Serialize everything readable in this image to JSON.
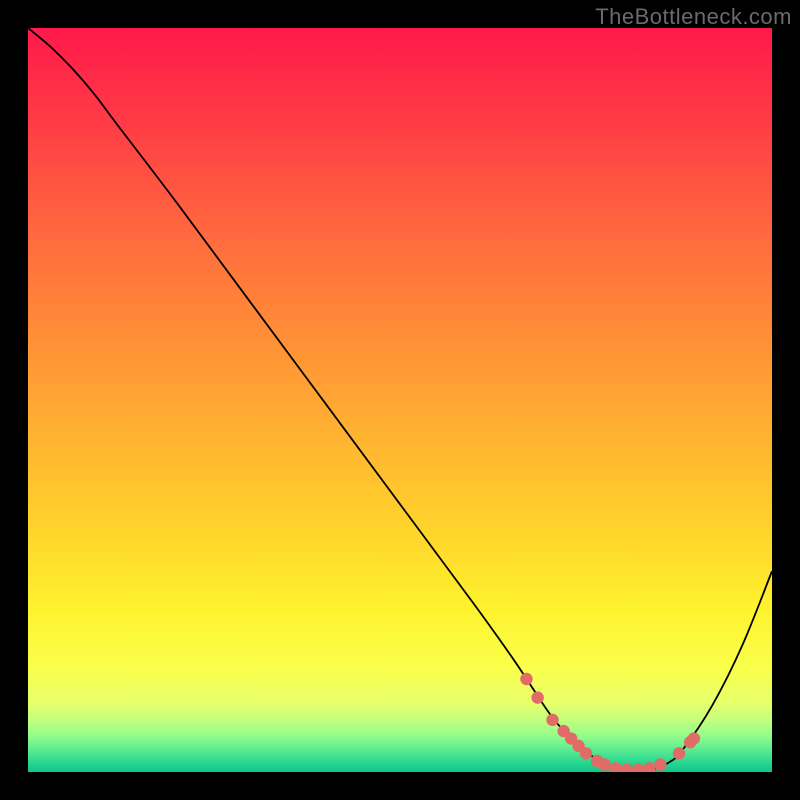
{
  "watermark": "TheBottleneck.com",
  "chart_data": {
    "type": "line",
    "title": "",
    "xlabel": "",
    "ylabel": "",
    "xlim": [
      0,
      100
    ],
    "ylim": [
      0,
      100
    ],
    "grid": false,
    "series": [
      {
        "name": "curve",
        "x": [
          0,
          3,
          6,
          9,
          12,
          20,
          30,
          40,
          50,
          60,
          65,
          68,
          70,
          72,
          74,
          76,
          78,
          80,
          82,
          84,
          86,
          88,
          92,
          96,
          100
        ],
        "y": [
          100,
          97.5,
          94.5,
          91,
          87,
          76.5,
          63,
          49.5,
          36,
          22.5,
          15.5,
          11,
          8,
          5.5,
          3.5,
          2,
          1,
          0.4,
          0.2,
          0.4,
          1.2,
          3,
          9,
          17,
          27
        ]
      }
    ],
    "markers": {
      "name": "highlight-markers",
      "points": [
        {
          "x": 67,
          "y": 12.5
        },
        {
          "x": 68.5,
          "y": 10
        },
        {
          "x": 70.5,
          "y": 7
        },
        {
          "x": 72,
          "y": 5.5
        },
        {
          "x": 73,
          "y": 4.5
        },
        {
          "x": 74,
          "y": 3.5
        },
        {
          "x": 75,
          "y": 2.5
        },
        {
          "x": 76.5,
          "y": 1.5
        },
        {
          "x": 77.5,
          "y": 1
        },
        {
          "x": 79,
          "y": 0.5
        },
        {
          "x": 80.5,
          "y": 0.3
        },
        {
          "x": 82,
          "y": 0.3
        },
        {
          "x": 83.5,
          "y": 0.5
        },
        {
          "x": 85,
          "y": 1
        },
        {
          "x": 87.5,
          "y": 2.5
        },
        {
          "x": 89,
          "y": 4
        },
        {
          "x": 89.5,
          "y": 4.5
        }
      ]
    },
    "background_gradient_stops": [
      {
        "offset": 0,
        "color": "#ff194b"
      },
      {
        "offset": 0.13,
        "color": "#ff3c45"
      },
      {
        "offset": 0.28,
        "color": "#ff6a3e"
      },
      {
        "offset": 0.42,
        "color": "#ff9036"
      },
      {
        "offset": 0.55,
        "color": "#ffb330"
      },
      {
        "offset": 0.68,
        "color": "#ffd52b"
      },
      {
        "offset": 0.78,
        "color": "#fef22e"
      },
      {
        "offset": 0.86,
        "color": "#faff4a"
      },
      {
        "offset": 0.905,
        "color": "#e8ff6a"
      },
      {
        "offset": 0.93,
        "color": "#c4ff7d"
      },
      {
        "offset": 0.95,
        "color": "#97fd88"
      },
      {
        "offset": 0.965,
        "color": "#6af18f"
      },
      {
        "offset": 0.978,
        "color": "#43e291"
      },
      {
        "offset": 0.99,
        "color": "#24d38f"
      },
      {
        "offset": 1.0,
        "color": "#0fc688"
      }
    ]
  }
}
